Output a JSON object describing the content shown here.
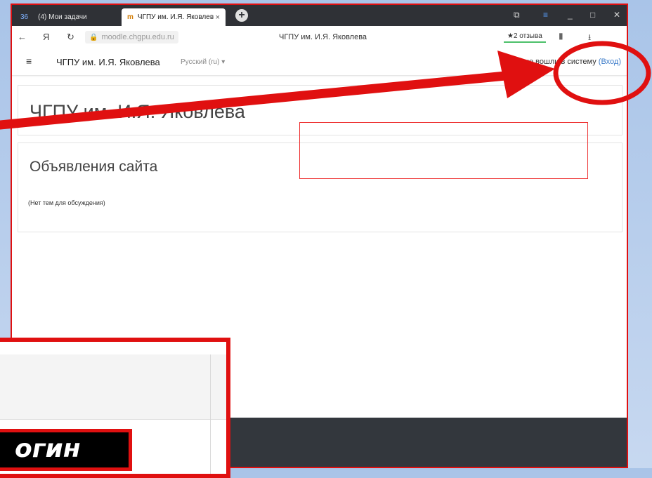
{
  "browser": {
    "tabs": [
      {
        "badge": "36",
        "label": "(4) Мои задачи"
      },
      {
        "favicon": "m",
        "label": "ЧГПУ им. И.Я. Яковлев",
        "close": "×"
      }
    ],
    "new_tab": "+",
    "address": {
      "back": "←",
      "yandex": "Я",
      "reload": "↻",
      "url": "moodle.chgpu.edu.ru",
      "page_title": "ЧГПУ им. И.Я. Яковлева",
      "reviews": "★2 отзыва"
    }
  },
  "site": {
    "menu_icon": "≡",
    "brand": "ЧГПУ им. И.Я. Яковлева",
    "language": "Русский (ru) ▾",
    "login_prefix": "Вы не вошли в систему",
    "login_link": "(Вход)",
    "heading": "ЧГПУ им. И.Я. Яковлева",
    "announcements_title": "Объявления сайта",
    "announcements_empty": "(Нет тем для обсуждения)"
  },
  "inset": {
    "button_text": "огин"
  },
  "colors": {
    "annotation_red": "#e01010",
    "link": "#3d7cc9",
    "footer": "#33373d"
  }
}
